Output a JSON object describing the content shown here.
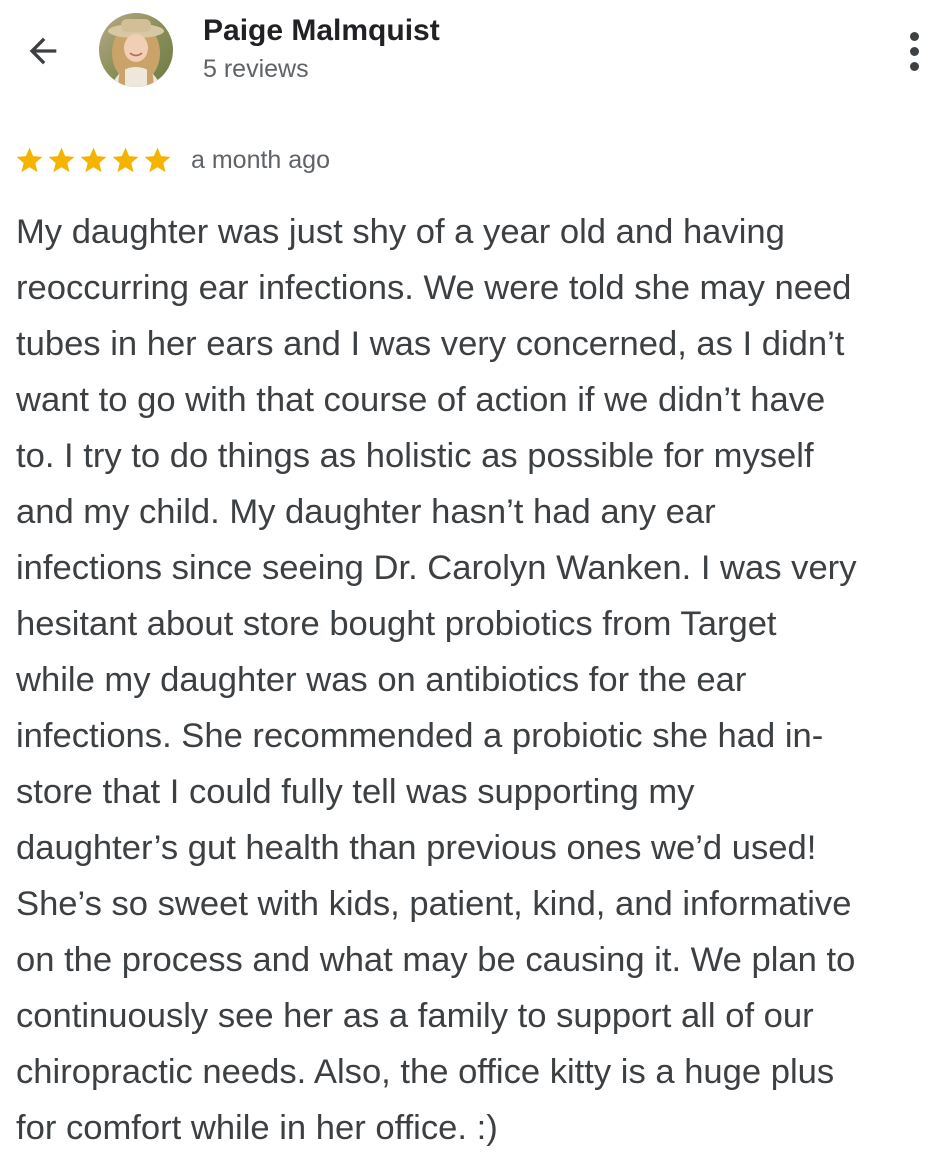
{
  "header": {
    "back_icon": "arrow-back-icon",
    "reviewer_name": "Paige Malmquist",
    "review_count": "5 reviews",
    "more_icon": "more-vert-icon"
  },
  "review": {
    "rating": 5,
    "max_rating": 5,
    "star_color": "#f4b400",
    "time_ago": "a month ago",
    "text": "My daughter was just shy of a year old and having\nreoccurring ear infections. We were told she may need\ntubes in her ears and I was very concerned, as I didn’t\nwant to go with that course of action if we didn’t have\nto. I try to do things as holistic as possible for myself\nand my child. My daughter hasn’t had any ear\ninfections since seeing Dr. Carolyn Wanken. I was very\nhesitant about store bought probiotics from Target\nwhile my daughter was on antibiotics for the ear\ninfections. She recommended a probiotic she had in-\nstore that I could fully tell was supporting my\ndaughter’s gut health than previous ones we’d used!\nShe’s so sweet with kids, patient, kind, and informative\non the process and what may be causing it. We plan to\ncontinuously see her as a family to support all of our\nchiropractic needs. Also, the office kitty is a huge plus\nfor comfort while in her office. :)"
  }
}
